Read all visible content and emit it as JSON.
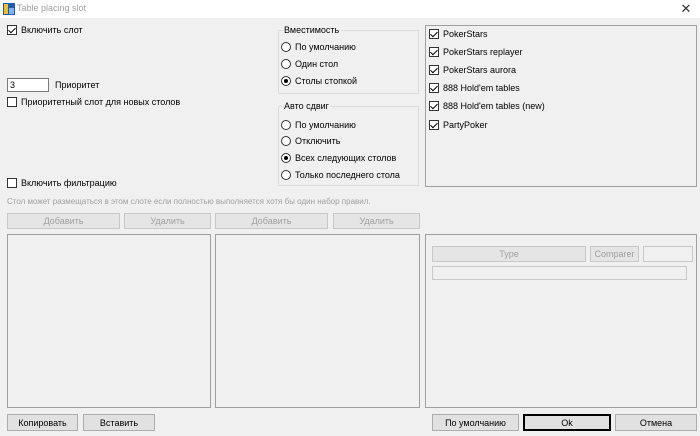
{
  "window": {
    "title": "Table placing slot",
    "close_symbol": "✕"
  },
  "enable_slot": {
    "label": "Включить слот",
    "checked": true
  },
  "priority": {
    "value": "3",
    "label": "Приоритет"
  },
  "priority_new_tables": {
    "label": "Приоритетный слот для новых столов",
    "checked": false
  },
  "capacity": {
    "title": "Вместимость",
    "options": [
      {
        "label": "По умолчанию",
        "selected": false
      },
      {
        "label": "Один стол",
        "selected": false
      },
      {
        "label": "Столы стопкой",
        "selected": true
      }
    ]
  },
  "auto_shift": {
    "title": "Авто сдвиг",
    "options": [
      {
        "label": "По умолчанию",
        "selected": false
      },
      {
        "label": "Отключить",
        "selected": false
      },
      {
        "label": "Всех следующих столов",
        "selected": true
      },
      {
        "label": "Только последнего стола",
        "selected": false
      }
    ]
  },
  "rooms": [
    {
      "label": "PokerStars",
      "checked": true
    },
    {
      "label": "PokerStars replayer",
      "checked": true
    },
    {
      "label": "PokerStars aurora",
      "checked": true
    },
    {
      "label": "888 Hold'em tables",
      "checked": true
    },
    {
      "label": "888 Hold'em tables (new)",
      "checked": true
    },
    {
      "label": "PartyPoker",
      "checked": true
    }
  ],
  "filtering": {
    "label": "Включить фильтрацию",
    "checked": false,
    "hint": "Стол может размещаться в этом слоте если полностью выполняется хотя бы один набор правил."
  },
  "left_list": {
    "add": "Добавить",
    "remove": "Удалить"
  },
  "right_list": {
    "add": "Добавить",
    "remove": "Удалить"
  },
  "rule_editor": {
    "type_label": "Type",
    "comparer_label": "Comparer"
  },
  "footer": {
    "copy": "Копировать",
    "paste": "Вставить",
    "default": "По умолчанию",
    "ok": "Ok",
    "cancel": "Отмена"
  }
}
